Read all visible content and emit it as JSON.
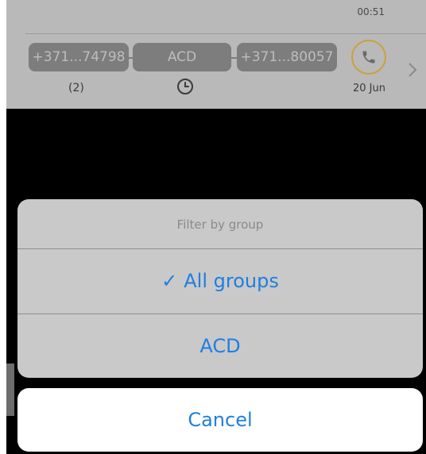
{
  "call_row": {
    "time": "00:51",
    "from_number": "+371...74798",
    "group": "ACD",
    "to_number": "+371...80057",
    "count": "(2)",
    "date": "20 Jun",
    "accent_color": "#c8a23a",
    "icons": [
      "clock-icon",
      "phone-icon",
      "chevron-right-icon"
    ]
  },
  "action_sheet": {
    "title": "Filter by group",
    "options": [
      {
        "label": "All groups",
        "selected": true,
        "check": "✓"
      },
      {
        "label": "ACD",
        "selected": false
      }
    ],
    "cancel_label": "Cancel",
    "accent_color": "#1f7fe0"
  }
}
